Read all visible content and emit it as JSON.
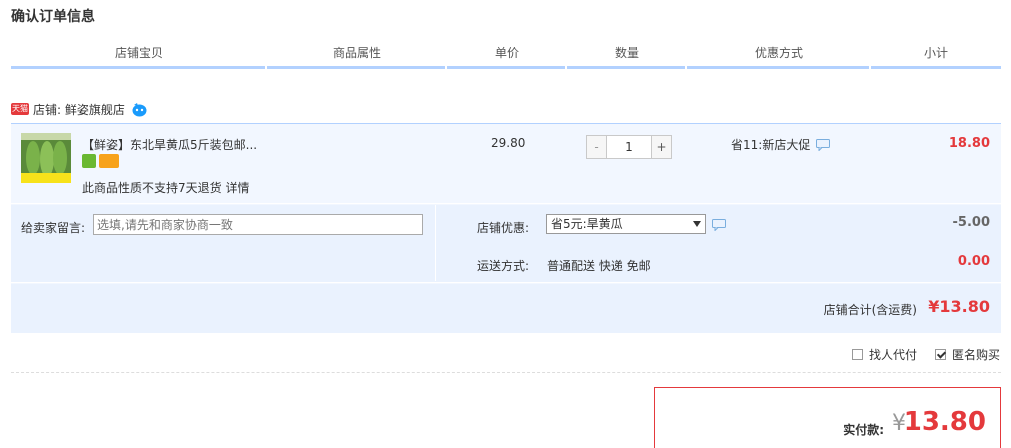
{
  "page_title": "确认订单信息",
  "columns": [
    "店铺宝贝",
    "商品属性",
    "单价",
    "数量",
    "优惠方式",
    "小计"
  ],
  "shop": {
    "badge": "天猫",
    "label": "店铺: 鲜姿旗舰店"
  },
  "item": {
    "title": "【鲜姿】东北旱黄瓜5斤装包邮...",
    "note": "此商品性质不支持7天退货 详情",
    "price": "29.80",
    "qty_minus": "-",
    "qty_value": "1",
    "qty_plus": "+",
    "discount": "省11:新店大促",
    "subtotal": "18.80"
  },
  "message": {
    "label": "给卖家留言:",
    "placeholder": "选填,请先和商家协商一致"
  },
  "shop_discount": {
    "label": "店铺优惠:",
    "selected": "省5元:旱黄瓜",
    "amount": "-5.00"
  },
  "shipping": {
    "label": "运送方式:",
    "value": "普通配送 快递 免邮",
    "amount": "0.00"
  },
  "shop_total": {
    "label": "店铺合计(含运费)",
    "value": "¥13.80"
  },
  "options": {
    "proxy_pay": "找人代付",
    "anonymous": "匿名购买"
  },
  "pay": {
    "label": "实付款:",
    "yen": "¥",
    "value": "13.80"
  },
  "colors": {
    "accent_red": "#e4393c",
    "header_bar": "#b2d1ff",
    "row_bg": "#f2f7ff"
  }
}
